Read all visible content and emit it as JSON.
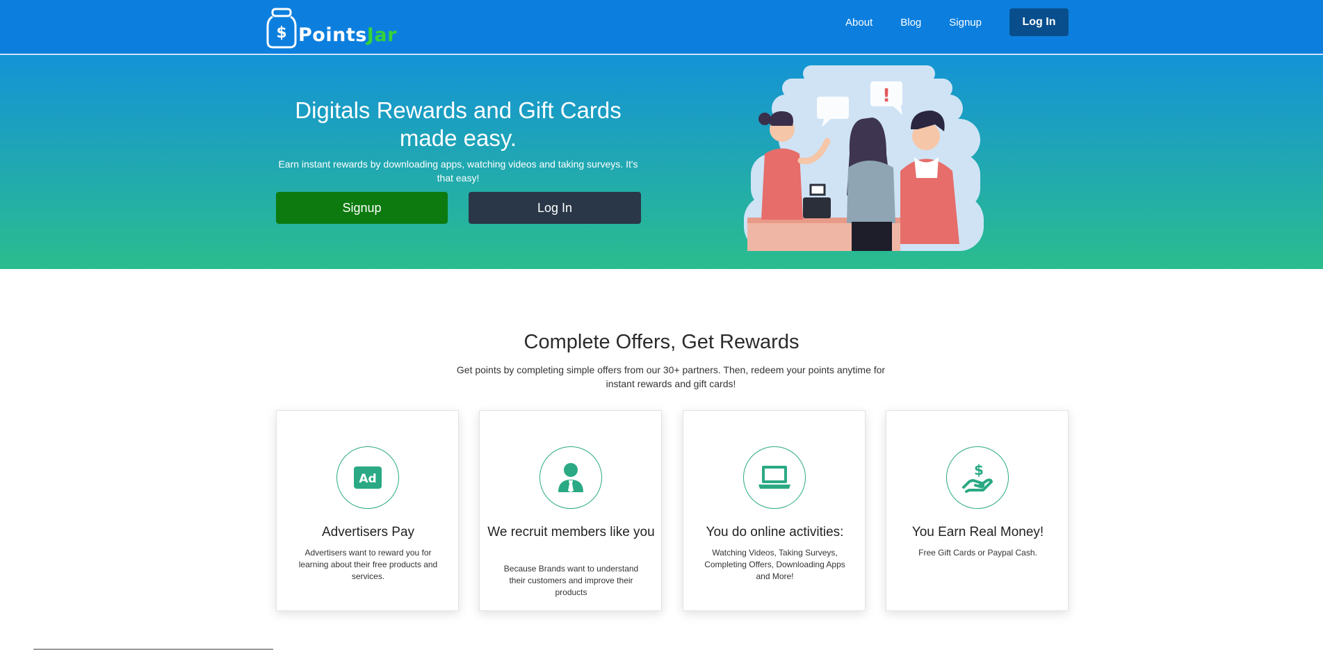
{
  "brand": {
    "name_part1": "Points",
    "name_part2": "Jar"
  },
  "nav": {
    "about": "About",
    "blog": "Blog",
    "signup": "Signup",
    "login": "Log In"
  },
  "hero": {
    "title": "Digitals Rewards and Gift Cards made easy.",
    "subtitle": "Earn instant rewards by downloading apps, watching videos and taking surveys. It's that easy!",
    "signup_button": "Signup",
    "login_button": "Log In"
  },
  "section": {
    "title": "Complete Offers, Get Rewards",
    "subtitle": "Get points by completing simple offers from our 30+ partners. Then, redeem your points anytime for instant rewards and gift cards!"
  },
  "cards": [
    {
      "icon": "ad-icon",
      "title": "Advertisers Pay",
      "description": "Advertisers want to reward you for learning about their free products and services."
    },
    {
      "icon": "user-tie-icon",
      "title": "We recruit members like you",
      "description": "Because Brands want to understand their customers and improve their products"
    },
    {
      "icon": "laptop-icon",
      "title": "You do online activities:",
      "description": "Watching Videos, Taking Surveys, Completing Offers, Downloading Apps and More!"
    },
    {
      "icon": "hand-dollar-icon",
      "title": "You Earn Real Money!",
      "description": "Free Gift Cards or Paypal Cash."
    }
  ],
  "colors": {
    "nav_bg": "#0c7fde",
    "login_bg": "#084e8c",
    "signup_green": "#0c7a0f",
    "dark_button": "#2a3748",
    "accent_teal": "#2aa984",
    "logo_green": "#35d33a"
  }
}
